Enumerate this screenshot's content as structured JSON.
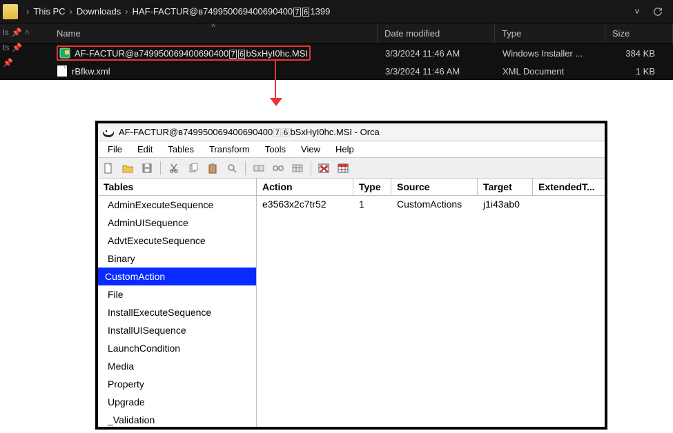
{
  "explorer": {
    "breadcrumb": {
      "pc": "This PC",
      "downloads": "Downloads",
      "folder_prefix": "HAF-FACTUR@в749950069400690400",
      "folder_box1": "7",
      "folder_box2": "6",
      "folder_suffix": "1399"
    },
    "columns": {
      "name": "Name",
      "date": "Date modified",
      "type": "Type",
      "size": "Size"
    },
    "sidebar": {
      "item1": "ls",
      "item2": "ts"
    },
    "rows": [
      {
        "name_prefix": "AF-FACTUR@в749950069400690400",
        "name_box1": "7",
        "name_box2": "6",
        "name_suffix": "bSxHyI0hc.MSI",
        "date": "3/3/2024 11:46 AM",
        "type": "Windows Installer ...",
        "size": "384 KB",
        "highlighted": true,
        "icon": "msi"
      },
      {
        "name_prefix": "rBfkw.xml",
        "name_box1": "",
        "name_box2": "",
        "name_suffix": "",
        "date": "3/3/2024 11:46 AM",
        "type": "XML Document",
        "size": "1 KB",
        "highlighted": false,
        "icon": "xml"
      }
    ]
  },
  "orca": {
    "title_prefix": "AF-FACTUR@в749950069400690400",
    "title_box1": "7",
    "title_box2": "6",
    "title_mid": "bSxHyI0hc.MSI",
    "title_app": " - Orca",
    "menu": {
      "file": "File",
      "edit": "Edit",
      "tables": "Tables",
      "transform": "Transform",
      "tools": "Tools",
      "view": "View",
      "help": "Help"
    },
    "left_header": "Tables",
    "tables": [
      "AdminExecuteSequence",
      "AdminUISequence",
      "AdvtExecuteSequence",
      "Binary",
      "CustomAction",
      "File",
      "InstallExecuteSequence",
      "InstallUISequence",
      "LaunchCondition",
      "Media",
      "Property",
      "Upgrade",
      "_Validation"
    ],
    "selected_table": "CustomAction",
    "grid_headers": {
      "action": "Action",
      "type": "Type",
      "source": "Source",
      "target": "Target",
      "ext": "ExtendedT..."
    },
    "grid_row": {
      "action": "e3563x2c7tr52",
      "type": "1",
      "source": "CustomActions",
      "target": "j1i43ab0",
      "ext": ""
    }
  }
}
